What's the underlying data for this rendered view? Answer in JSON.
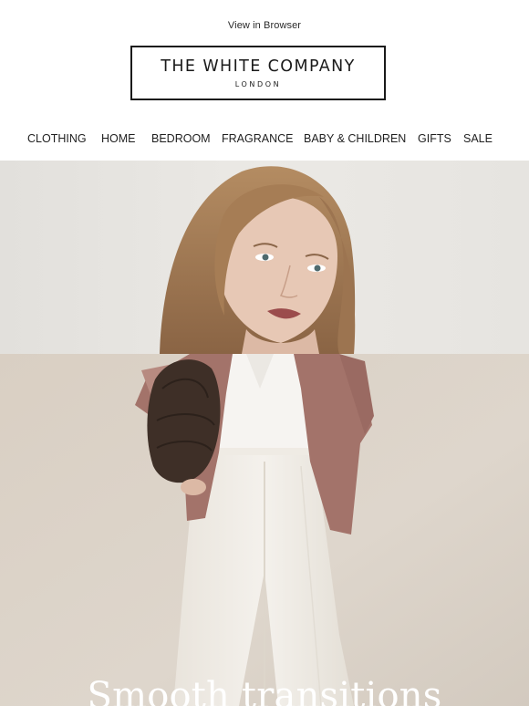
{
  "header": {
    "view_in_browser": "View in Browser",
    "brand_name": "THE WHITE COMPANY",
    "brand_sub": "LONDON"
  },
  "nav": {
    "items": [
      {
        "label": "CLOTHING"
      },
      {
        "label": "HOME"
      },
      {
        "label": "BEDROOM"
      },
      {
        "label": "FRAGRANCE"
      },
      {
        "label": "BABY & CHILDREN"
      },
      {
        "label": "GIFTS"
      },
      {
        "label": "SALE"
      }
    ]
  },
  "hero": {
    "headline": "Smooth transitions",
    "image_alt_icon": "model-photo"
  },
  "colors": {
    "background": "#ffffff",
    "text": "#1f1f1f",
    "hero_top_bg": "#e8e6e2",
    "hero_bottom_bg": "#dcd3c9",
    "shirt": "#a07269",
    "trousers": "#f1ede6",
    "bag": "#3e2f27"
  }
}
